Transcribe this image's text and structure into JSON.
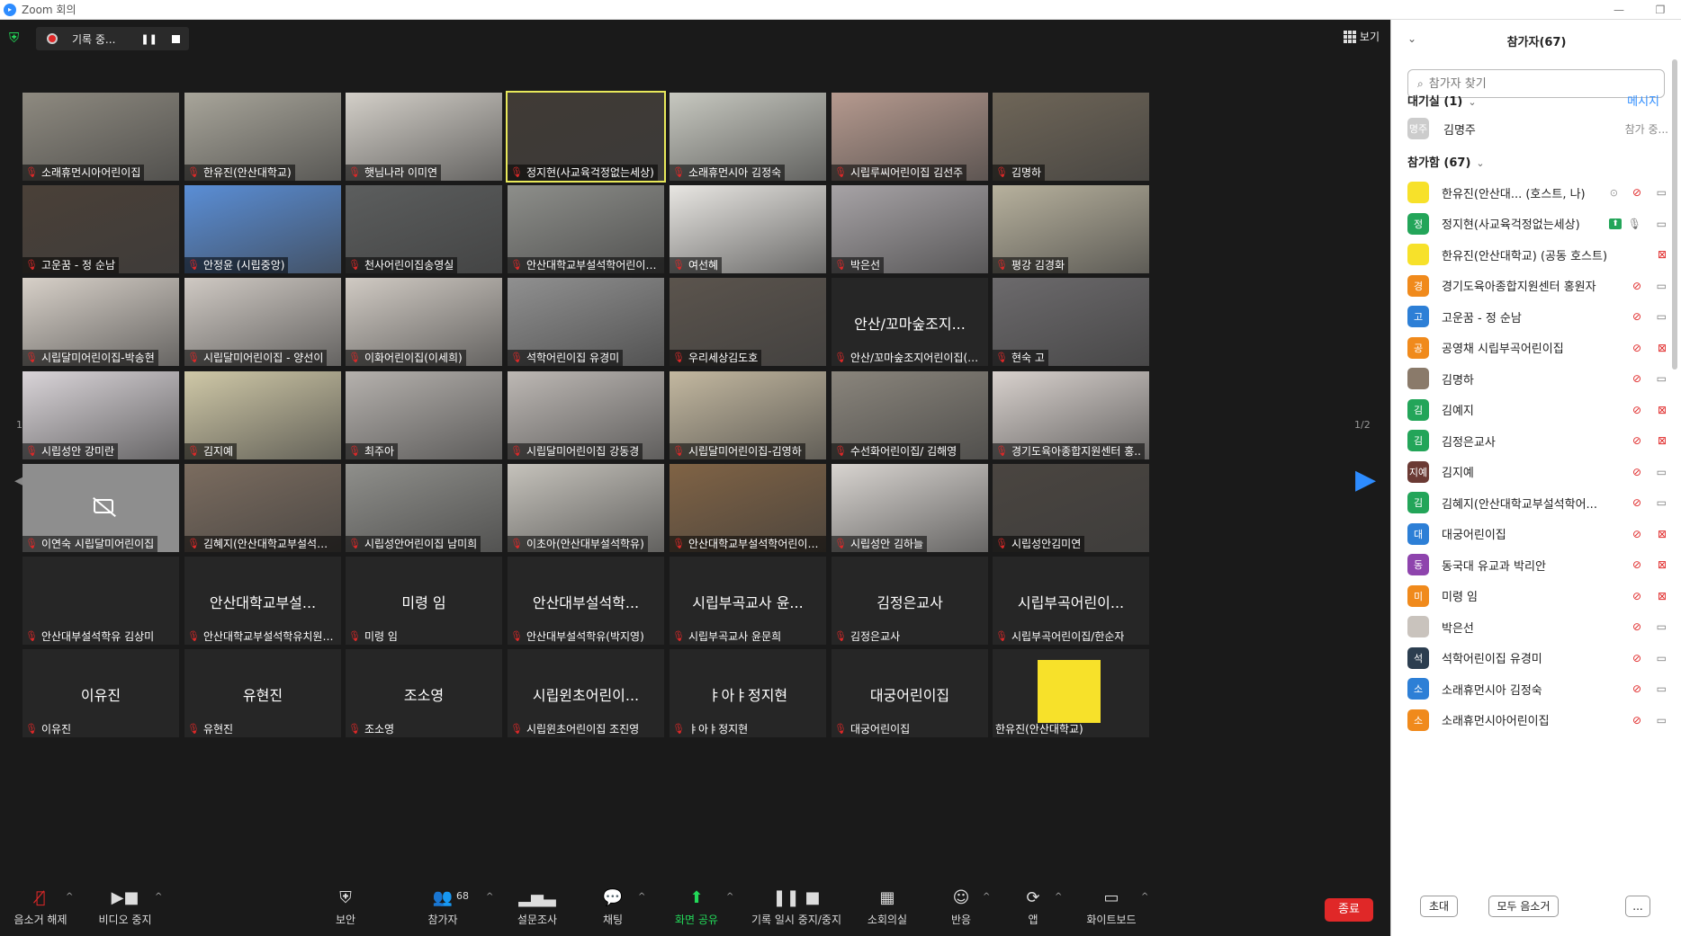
{
  "window": {
    "title": "Zoom 회의"
  },
  "recording": {
    "label": "기록 중..."
  },
  "view_label": "보기",
  "page_indicator": "1/2",
  "tiles": [
    {
      "label": "소래휴먼시아어린이집",
      "kind": "cam",
      "bg": "#8e8a80"
    },
    {
      "label": "한유진(안산대학교)",
      "kind": "cam",
      "bg": "#a8a59a"
    },
    {
      "label": "햇님나라 이미연",
      "kind": "cam",
      "bg": "#d3cfc8"
    },
    {
      "label": "정지현(사교육걱정없는세상)",
      "kind": "cam",
      "bg": "#403a35",
      "active": true
    },
    {
      "label": "소래휴먼시아 김정숙",
      "kind": "cam",
      "bg": "#c7c8c0"
    },
    {
      "label": "시립루씨어린이집 김선주",
      "kind": "cam",
      "bg": "#b69a8f"
    },
    {
      "label": "김명하",
      "kind": "cam",
      "bg": "#6f6658"
    },
    {
      "label": "고운꿈 - 정 순남",
      "kind": "cam",
      "bg": "#4a4038"
    },
    {
      "label": "안정윤 (시립중앙)",
      "kind": "cam",
      "bg": "#5a8ed6"
    },
    {
      "label": "천사어린이집송영실",
      "kind": "cam",
      "bg": "#5c5e5e"
    },
    {
      "label": "안산대학교부설석학어린이집 ...",
      "kind": "cam",
      "bg": "#8d8e8a"
    },
    {
      "label": "여선혜",
      "kind": "cam",
      "bg": "#e8e6e2"
    },
    {
      "label": "박은선",
      "kind": "cam",
      "bg": "#a7a3a6"
    },
    {
      "label": "평강 김경화",
      "kind": "cam",
      "bg": "#b7b19d"
    },
    {
      "label": "시립달미어린이집-박송현",
      "kind": "cam",
      "bg": "#d7d0c8"
    },
    {
      "label": "시립달미어린이집 - 양선이",
      "kind": "cam",
      "bg": "#cfc9c3"
    },
    {
      "label": "이화어린이집(이세희)",
      "kind": "cam",
      "bg": "#d0cac3"
    },
    {
      "label": "석학어린이집 유경미",
      "kind": "cam",
      "bg": "#909090"
    },
    {
      "label": "우리세상김도호",
      "kind": "cam",
      "bg": "#5b544d"
    },
    {
      "label": "안산/꼬마숲조지어린이집(김...",
      "kind": "name",
      "name": "안산/꼬마숲조지..."
    },
    {
      "label": "현숙 고",
      "kind": "cam",
      "bg": "#6c6a6c"
    },
    {
      "label": "시립성안 강미란",
      "kind": "cam",
      "bg": "#d9d4d8"
    },
    {
      "label": "김지예",
      "kind": "cam",
      "bg": "#cfc8a7"
    },
    {
      "label": "최주아",
      "kind": "cam",
      "bg": "#b5b1ad"
    },
    {
      "label": "시립달미어린이집 강동경",
      "kind": "cam",
      "bg": "#bdb8b4"
    },
    {
      "label": "시립달미어린이집-김영하",
      "kind": "cam",
      "bg": "#c3b8a0"
    },
    {
      "label": "수선화어린이집/ 김해영",
      "kind": "cam",
      "bg": "#8a857c"
    },
    {
      "label": "경기도육아종합지원센터 홍..",
      "kind": "cam",
      "bg": "#d8d1cd"
    },
    {
      "label": "이연숙 시립달미어린이집",
      "kind": "camoff"
    },
    {
      "label": "김혜지(안산대학교부설석학어...",
      "kind": "cam",
      "bg": "#7b6c5f"
    },
    {
      "label": "시립성안어린이집 남미희",
      "kind": "cam",
      "bg": "#8f8f8b"
    },
    {
      "label": "이초아(안산대부설석학유)",
      "kind": "cam",
      "bg": "#c5c2bb"
    },
    {
      "label": "안산대학교부설석학어린이집 ...",
      "kind": "cam",
      "bg": "#806345"
    },
    {
      "label": "시립성안 김하늘",
      "kind": "cam",
      "bg": "#d8d4d0"
    },
    {
      "label": "시립성안김미연",
      "kind": "cam",
      "bg": "#4a4540"
    },
    {
      "label": "안산대부설석학유 김상미",
      "kind": "name",
      "name": ""
    },
    {
      "label": "안산대학교부설석학유치원(이...",
      "kind": "name",
      "name": "안산대학교부설..."
    },
    {
      "label": "미령 임",
      "kind": "name",
      "name": "미령 임"
    },
    {
      "label": "안산대부설석학유(박지영)",
      "kind": "name",
      "name": "안산대부설석학..."
    },
    {
      "label": "시립부곡교사 윤문희",
      "kind": "name",
      "name": "시립부곡교사 윤..."
    },
    {
      "label": "김정은교사",
      "kind": "name",
      "name": "김정은교사"
    },
    {
      "label": "시립부곡어린이집/한순자",
      "kind": "name",
      "name": "시립부곡어린이..."
    },
    {
      "label": "이유진",
      "kind": "name",
      "name": "이유진"
    },
    {
      "label": "유현진",
      "kind": "name",
      "name": "유현진"
    },
    {
      "label": "조소영",
      "kind": "name",
      "name": "조소영"
    },
    {
      "label": "시립윈초어린이집 조진영",
      "kind": "name",
      "name": "시립윈초어린이..."
    },
    {
      "label": "ㅑ아ㅑ정지현",
      "kind": "name",
      "name": "ㅑ아ㅑ정지현"
    },
    {
      "label": "대궁어린이집",
      "kind": "name",
      "name": "대궁어린이집"
    },
    {
      "label": "한유진(안산대학교)",
      "kind": "avatar",
      "nomic": true
    }
  ],
  "toolbar": {
    "unmute": "음소거 해제",
    "video": "비디오 중지",
    "security": "보안",
    "participants": "참가자",
    "participants_count": "68",
    "polls": "설문조사",
    "chat": "채팅",
    "share": "화면 공유",
    "pause_rec": "기록 일시 중지/중지",
    "breakout": "소회의실",
    "reactions": "반응",
    "apps": "앱",
    "whiteboard": "화이트보드",
    "end": "종료"
  },
  "panel": {
    "title": "참가자(67)",
    "search_placeholder": "참가자 찾기",
    "waiting_section": "대기실 (1)",
    "message_link": "메시지",
    "waiting": [
      {
        "initials": "명주",
        "name": "김명주",
        "action": "참가 중..."
      }
    ],
    "in_meeting_section": "참가함 (67)",
    "participants": [
      {
        "name": "한유진(안산대...  (호스트, 나)",
        "initials": "",
        "color": "#f7e12a",
        "mic": "off",
        "cam": "on",
        "rec": true
      },
      {
        "name": "정지현(사교육걱정없는세상)",
        "initials": "정",
        "color": "#23a559",
        "mic": "on",
        "cam": "on",
        "share": true
      },
      {
        "name": "한유진(안산대학교) (공동 호스트)",
        "initials": "",
        "color": "#f7e12a",
        "mic": "none",
        "cam": "off"
      },
      {
        "name": "경기도육아종합지원센터 홍원자",
        "initials": "경",
        "color": "#f08a1c",
        "mic": "off",
        "cam": "on"
      },
      {
        "name": "고운꿈 - 정 순남",
        "initials": "고",
        "color": "#2d7fd6",
        "mic": "off",
        "cam": "on"
      },
      {
        "name": "공영채 시립부곡어린이집",
        "initials": "공",
        "color": "#f08a1c",
        "mic": "off",
        "cam": "off"
      },
      {
        "name": "김명하",
        "initials": "",
        "color": "#8a7a6a",
        "mic": "off",
        "cam": "on"
      },
      {
        "name": "김예지",
        "initials": "김",
        "color": "#23a559",
        "mic": "off",
        "cam": "off"
      },
      {
        "name": "김정은교사",
        "initials": "김",
        "color": "#23a559",
        "mic": "off",
        "cam": "off"
      },
      {
        "name": "김지예",
        "initials": "지예",
        "color": "#6b3a34",
        "mic": "off",
        "cam": "on"
      },
      {
        "name": "김혜지(안산대학교부설석학어...",
        "initials": "김",
        "color": "#23a559",
        "mic": "off",
        "cam": "on"
      },
      {
        "name": "대궁어린이집",
        "initials": "대",
        "color": "#2d7fd6",
        "mic": "off",
        "cam": "off"
      },
      {
        "name": "동국대 유교과 박리안",
        "initials": "동",
        "color": "#8e44ad",
        "mic": "off",
        "cam": "off"
      },
      {
        "name": "미령 임",
        "initials": "미",
        "color": "#f08a1c",
        "mic": "off",
        "cam": "off"
      },
      {
        "name": "박은선",
        "initials": "",
        "color": "#c9c3bd",
        "mic": "off",
        "cam": "on"
      },
      {
        "name": "석학어린이집 유경미",
        "initials": "석",
        "color": "#2c3e50",
        "mic": "off",
        "cam": "on"
      },
      {
        "name": "소래휴먼시아 김정숙",
        "initials": "소",
        "color": "#2d7fd6",
        "mic": "off",
        "cam": "on"
      },
      {
        "name": "소래휴먼시아어린이집",
        "initials": "소",
        "color": "#f08a1c",
        "mic": "off",
        "cam": "on"
      }
    ],
    "invite": "초대",
    "mute_all": "모두 음소거",
    "more": "..."
  }
}
